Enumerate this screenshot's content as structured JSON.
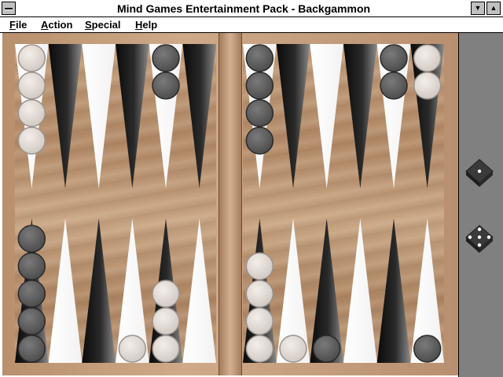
{
  "window": {
    "title": "Mind Games Entertainment Pack - Backgammon",
    "minimize_glyph": "▼",
    "maximize_glyph": "▲"
  },
  "menu": {
    "items": [
      {
        "label": "File",
        "mnemonic": "F"
      },
      {
        "label": "Action",
        "mnemonic": "A"
      },
      {
        "label": "Special",
        "mnemonic": "S"
      },
      {
        "label": "Help",
        "mnemonic": "H"
      }
    ]
  },
  "colors": {
    "dark_point": "#1a1a1a",
    "light_point": "#ffffff",
    "dark_checker": "#5e5e5e",
    "light_checker": "#ddd6d0",
    "gutter": "#808080"
  },
  "board": {
    "top_points": [
      {
        "index": 0,
        "color": "light",
        "checkers": {
          "color": "light",
          "count": 4
        }
      },
      {
        "index": 1,
        "color": "dark",
        "checkers": null
      },
      {
        "index": 2,
        "color": "light",
        "checkers": null
      },
      {
        "index": 3,
        "color": "dark",
        "checkers": null
      },
      {
        "index": 4,
        "color": "light",
        "checkers": {
          "color": "dark",
          "count": 2
        }
      },
      {
        "index": 5,
        "color": "dark",
        "checkers": null
      },
      {
        "index": 6,
        "color": "light",
        "checkers": {
          "color": "dark",
          "count": 4
        }
      },
      {
        "index": 7,
        "color": "dark",
        "checkers": null
      },
      {
        "index": 8,
        "color": "light",
        "checkers": null
      },
      {
        "index": 9,
        "color": "dark",
        "checkers": null
      },
      {
        "index": 10,
        "color": "light",
        "checkers": {
          "color": "dark",
          "count": 2
        }
      },
      {
        "index": 11,
        "color": "dark",
        "checkers": {
          "color": "light",
          "count": 2
        }
      }
    ],
    "bottom_points": [
      {
        "index": 0,
        "color": "dark",
        "checkers": {
          "color": "dark",
          "count": 5
        }
      },
      {
        "index": 1,
        "color": "light",
        "checkers": null
      },
      {
        "index": 2,
        "color": "dark",
        "checkers": null
      },
      {
        "index": 3,
        "color": "light",
        "checkers": {
          "color": "light",
          "count": 1
        }
      },
      {
        "index": 4,
        "color": "dark",
        "checkers": {
          "color": "light",
          "count": 3
        }
      },
      {
        "index": 5,
        "color": "light",
        "checkers": null
      },
      {
        "index": 6,
        "color": "dark",
        "checkers": {
          "color": "light",
          "count": 4
        }
      },
      {
        "index": 7,
        "color": "light",
        "checkers": {
          "color": "light",
          "count": 1
        }
      },
      {
        "index": 8,
        "color": "dark",
        "checkers": {
          "color": "dark",
          "count": 1
        }
      },
      {
        "index": 9,
        "color": "light",
        "checkers": null
      },
      {
        "index": 10,
        "color": "dark",
        "checkers": null
      },
      {
        "index": 11,
        "color": "light",
        "checkers": {
          "color": "dark",
          "count": 1
        }
      }
    ]
  },
  "dice": [
    {
      "value": 1
    },
    {
      "value": 5
    }
  ]
}
